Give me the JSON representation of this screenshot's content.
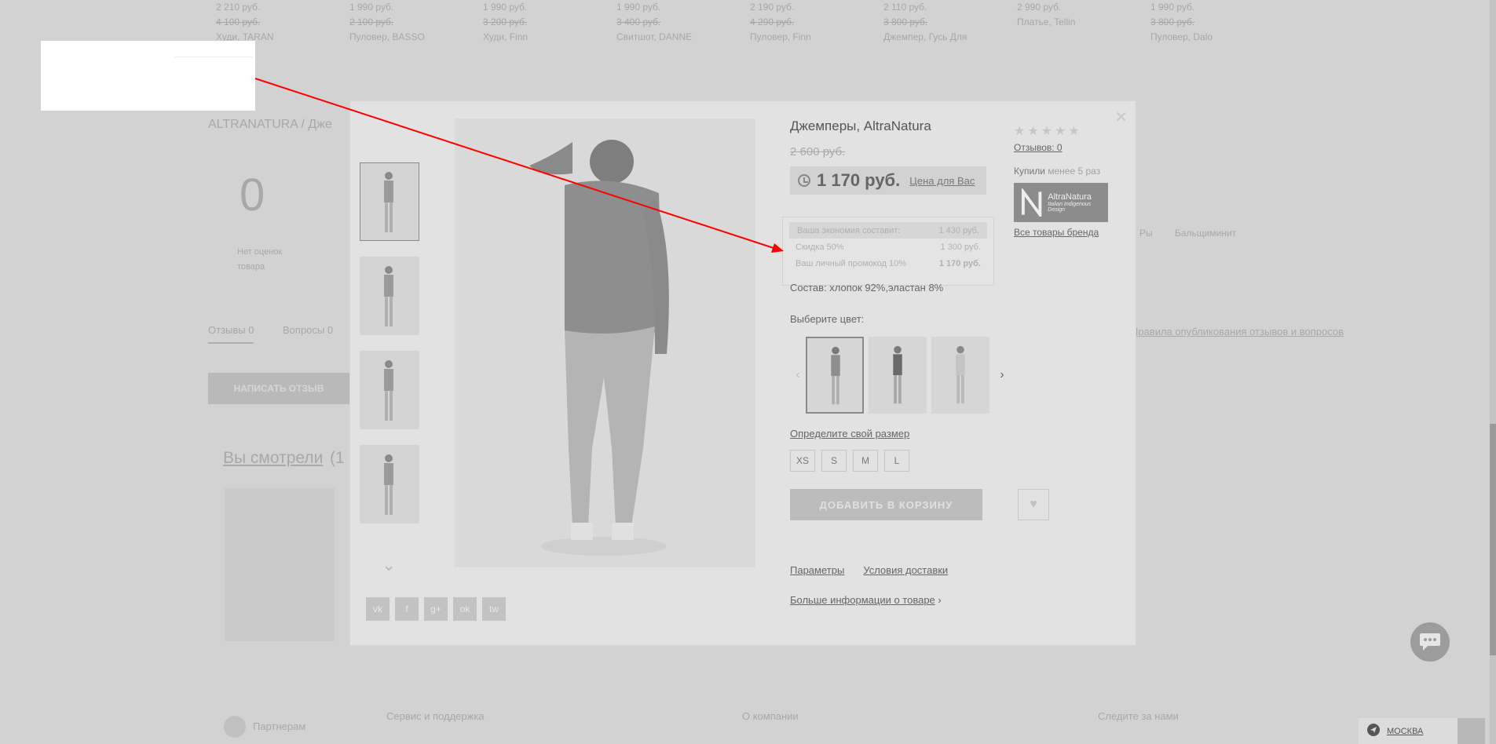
{
  "background": {
    "top_products": [
      {
        "price": "2 210 руб.",
        "old": "4 100 руб.",
        "name": "Худи, TARAN"
      },
      {
        "price": "1 990 руб.",
        "old": "2 100 руб.",
        "name": "Пуловер, BASSO"
      },
      {
        "price": "1 990 руб.",
        "old": "3 200 руб.",
        "name": "Худи, Finn"
      },
      {
        "price": "1 990 руб.",
        "old": "3 400 руб.",
        "name": "Свитшот, DANNE"
      },
      {
        "price": "2 190 руб.",
        "old": "4 290 руб.",
        "name": "Пуловер, Finn"
      },
      {
        "price": "2 110 руб.",
        "old": "3 800 руб.",
        "name": "Джемпер, Гусь Для"
      },
      {
        "price": "2 990 руб.",
        "old": "",
        "name": "Платье, Tellin"
      },
      {
        "price": "1 990 руб.",
        "old": "3 800 руб.",
        "name": "Пуловер, Dalo"
      }
    ],
    "breadcrumb": "ALTRANATURA / Дже",
    "rating_big": "0",
    "rating_caption": "Нет оценок\nтовара",
    "tab_reviews": "Отзывы 0",
    "tab_questions": "Вопросы 0",
    "write_review": "НАПИСАТЬ ОТЗЫВ",
    "watched": "Вы смотрели",
    "watched_count": "(1",
    "right_link": "Правила опубликования отзывов и вопросов",
    "right_tab": "Бальщиминит",
    "right_label": "Ры",
    "footer_partners": "Партнерам",
    "footer_service": "Сервис и поддержка",
    "footer_company": "О компании",
    "footer_follow": "Следите за нами"
  },
  "modal": {
    "title": "Джемперы, AltraNatura",
    "old_price": "2 600 руб.",
    "price": "1 170 руб.",
    "price_for_you": "Цена для Вас",
    "tooltip": {
      "savings_label": "Ваша экономия составит:",
      "savings_value": "1 430 руб.",
      "discount_label": "Скидка 50%",
      "discount_value": "1 300 руб.",
      "promo_label": "Ваш личный промокод 10%",
      "promo_value": "1 170 руб."
    },
    "composition": "Состав: хлопок 92%,эластан 8%",
    "choose_color": "Выберите цвет:",
    "size_link": "Определите свой размер",
    "sizes": [
      "XS",
      "S",
      "M",
      "L"
    ],
    "add_to_cart": "ДОБАВИТЬ В КОРЗИНУ",
    "link_params": "Параметры",
    "link_delivery": "Условия доставки",
    "more_info": "Больше информации о товаре",
    "more_info_arrow": "›",
    "stars": "★★★★★",
    "reviews": "Отзывов: 0",
    "bought_prefix": "Купили",
    "bought_value": "менее 5 раз",
    "brand_name": "AltraNatura",
    "brand_tagline": "Italian Indigenous Design",
    "all_brand_goods": "Все товары бренда",
    "share": [
      "vk",
      "f",
      "g+",
      "ok",
      "tw"
    ],
    "close_glyph": "✕",
    "thumb_next_glyph": "⌄",
    "swatch_prev_glyph": "‹",
    "swatch_next_glyph": "›",
    "fav_glyph": "♥"
  },
  "footer": {
    "city": "МОСКВА"
  },
  "colors": {
    "arrow": "#ff0000",
    "overlay": "#d2d2d2"
  }
}
